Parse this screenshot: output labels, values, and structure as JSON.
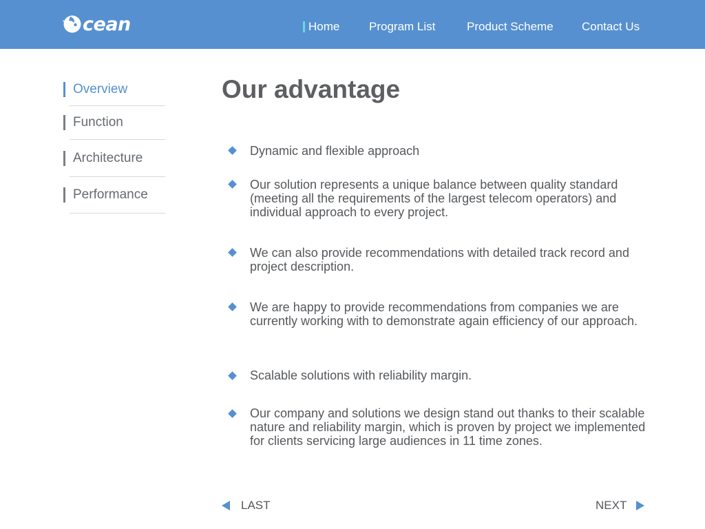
{
  "brand": {
    "logo_text": "cean",
    "accent": "#5690d0",
    "nav_marker": "#6ad7e5"
  },
  "nav": {
    "items": [
      {
        "label": "Home",
        "active": true
      },
      {
        "label": "Program List"
      },
      {
        "label": "Product Scheme"
      },
      {
        "label": "Contact Us"
      }
    ]
  },
  "sidebar": {
    "items": [
      {
        "label": "Overview",
        "active": true
      },
      {
        "label": "Function"
      },
      {
        "label": "Architecture"
      },
      {
        "label": "Performance"
      }
    ]
  },
  "main": {
    "title": "Our advantage",
    "items": [
      {
        "text": "Dynamic and flexible approach"
      },
      {
        "text": "Our solution represents a unique balance between quality standard (meeting all the requirements of the largest telecom operators) and individual approach to every project."
      },
      {
        "text": "We can also provide recommendations with detailed track record and project description."
      },
      {
        "text": "We are happy to provide recommendations from companies we are currently working with to demonstrate again efficiency of our approach."
      },
      {
        "text": "Scalable solutions with reliability margin."
      },
      {
        "text": "Our company and solutions we design stand out thanks to their scalable nature and reliability margin, which is proven by project we implemented for clients servicing large audiences in 11 time zones."
      }
    ]
  },
  "pager": {
    "prev_label": "LAST",
    "next_label": "NEXT"
  }
}
